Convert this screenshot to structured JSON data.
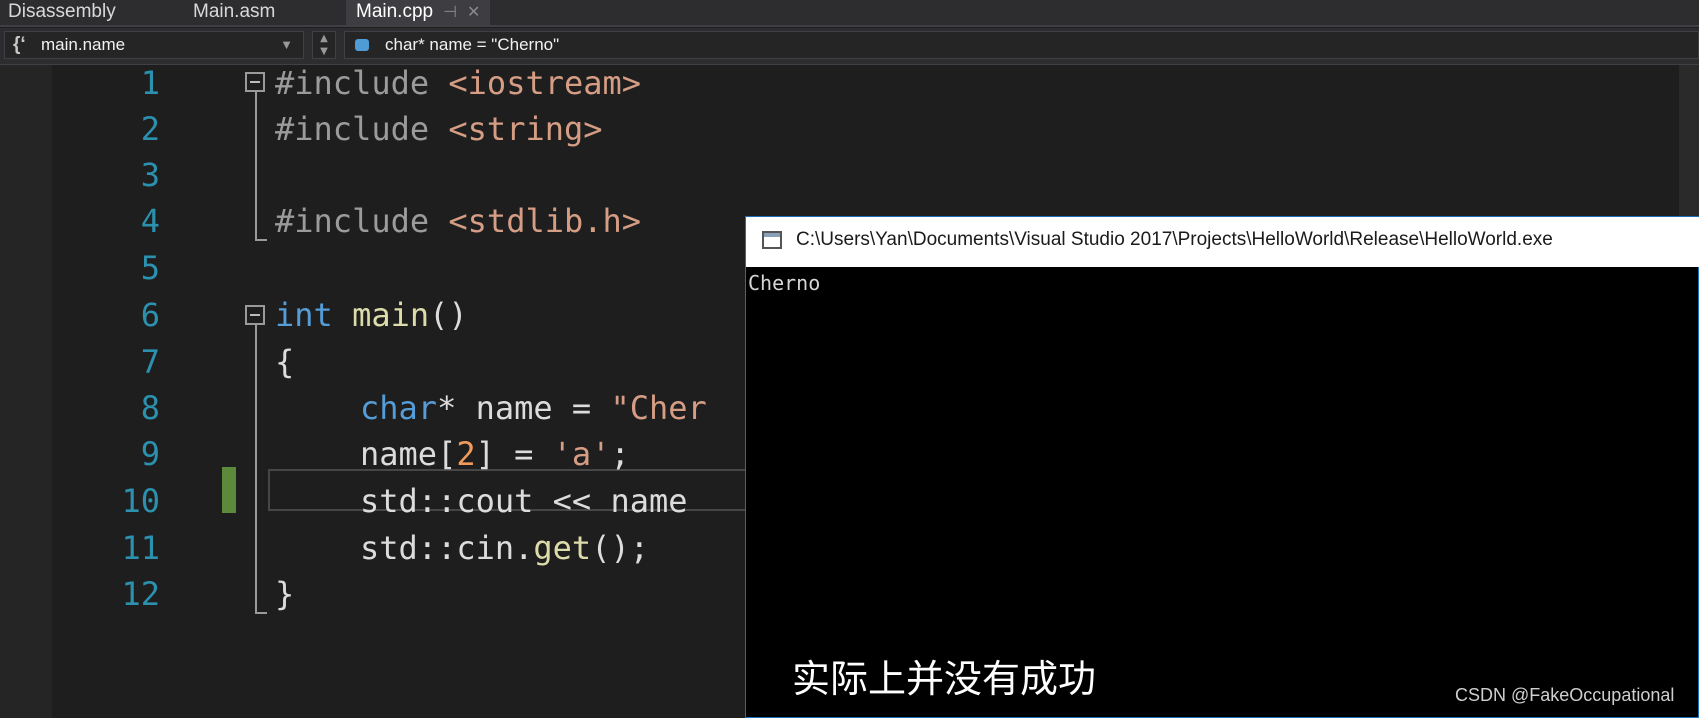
{
  "tabs": [
    {
      "label": "Disassembly"
    },
    {
      "label": "Main.asm"
    },
    {
      "label": "Main.cpp",
      "active": true
    }
  ],
  "navbar": {
    "scope": "main.name",
    "member": "char* name = \"Cherno\""
  },
  "editor": {
    "line_numbers": [
      "1",
      "2",
      "3",
      "4",
      "5",
      "6",
      "7",
      "8",
      "9",
      "10",
      "11",
      "12"
    ],
    "lines": {
      "l1_kw": "#include",
      "l1_rest": " <iostream>",
      "l2_kw": "#include",
      "l2_rest": " <string>",
      "l4_kw": "#include",
      "l4_rest": " <stdlib.h>",
      "l6_kw": "int",
      "l6_fn": " main",
      "l6_rest": "()",
      "l7": "{",
      "l8_kw": "char",
      "l8_rest": "* name = ",
      "l8_str": "\"Cher",
      "l9_a": "name[",
      "l9_num": "2",
      "l9_b": "] = ",
      "l9_str": "'a'",
      "l9_c": ";",
      "l10": "std::cout << name",
      "l11_a": "std::cin.",
      "l11_fn": "get",
      "l11_b": "();",
      "l12": "}"
    },
    "current_line": 9
  },
  "console": {
    "title": "C:\\Users\\Yan\\Documents\\Visual Studio 2017\\Projects\\HelloWorld\\Release\\HelloWorld.exe",
    "output": "Cherno"
  },
  "subtitle": "实际上并没有成功",
  "watermark": "CSDN @FakeOccupational"
}
